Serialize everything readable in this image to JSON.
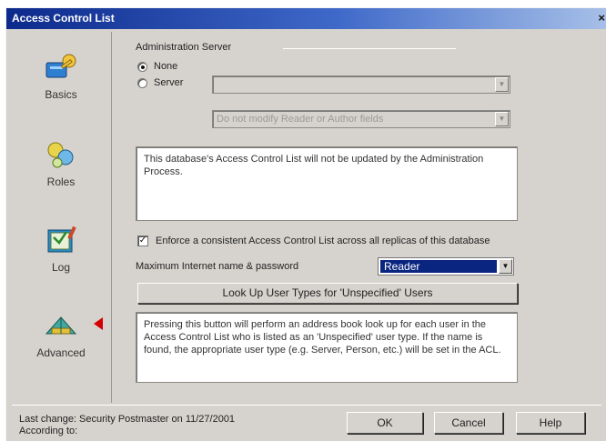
{
  "window": {
    "title": "Access Control List",
    "close": "×"
  },
  "sidebar": {
    "items": [
      {
        "label": "Basics",
        "icon": "key-icon"
      },
      {
        "label": "Roles",
        "icon": "roles-icon"
      },
      {
        "label": "Log",
        "icon": "log-book-icon"
      },
      {
        "label": "Advanced",
        "icon": "advanced-icon"
      }
    ],
    "selected": "Advanced",
    "selected_marker_color": "#d40000"
  },
  "admin_server": {
    "heading": "Administration Server",
    "none_label": "None",
    "server_label": "Server",
    "selected": "None",
    "server_value": "",
    "modify_option": "Do not modify Reader or Author fields",
    "info_text": "This database's Access Control List will not be updated by the Administration Process."
  },
  "enforce": {
    "checked": true,
    "label": "Enforce a consistent Access Control List across all replicas of this database"
  },
  "internet_access": {
    "label": "Maximum Internet name & password",
    "value": "Reader"
  },
  "lookup": {
    "button_label": "Look Up User Types for 'Unspecified' Users",
    "description": "Pressing this button will perform an address book look up for each user in the Access Control List who is listed as an 'Unspecified' user type.  If the name is found, the appropriate user type (e.g. Server, Person, etc.) will be set in the ACL."
  },
  "footer": {
    "last_change": "Last change: Security Postmaster on 11/27/2001",
    "according_to": "According to:",
    "ok_label": "OK",
    "cancel_label": "Cancel",
    "help_label": "Help"
  },
  "colors": {
    "title_bar": "#0c2a8c",
    "dialog_bg": "#d6d3ce",
    "selection": "#0a2580"
  }
}
